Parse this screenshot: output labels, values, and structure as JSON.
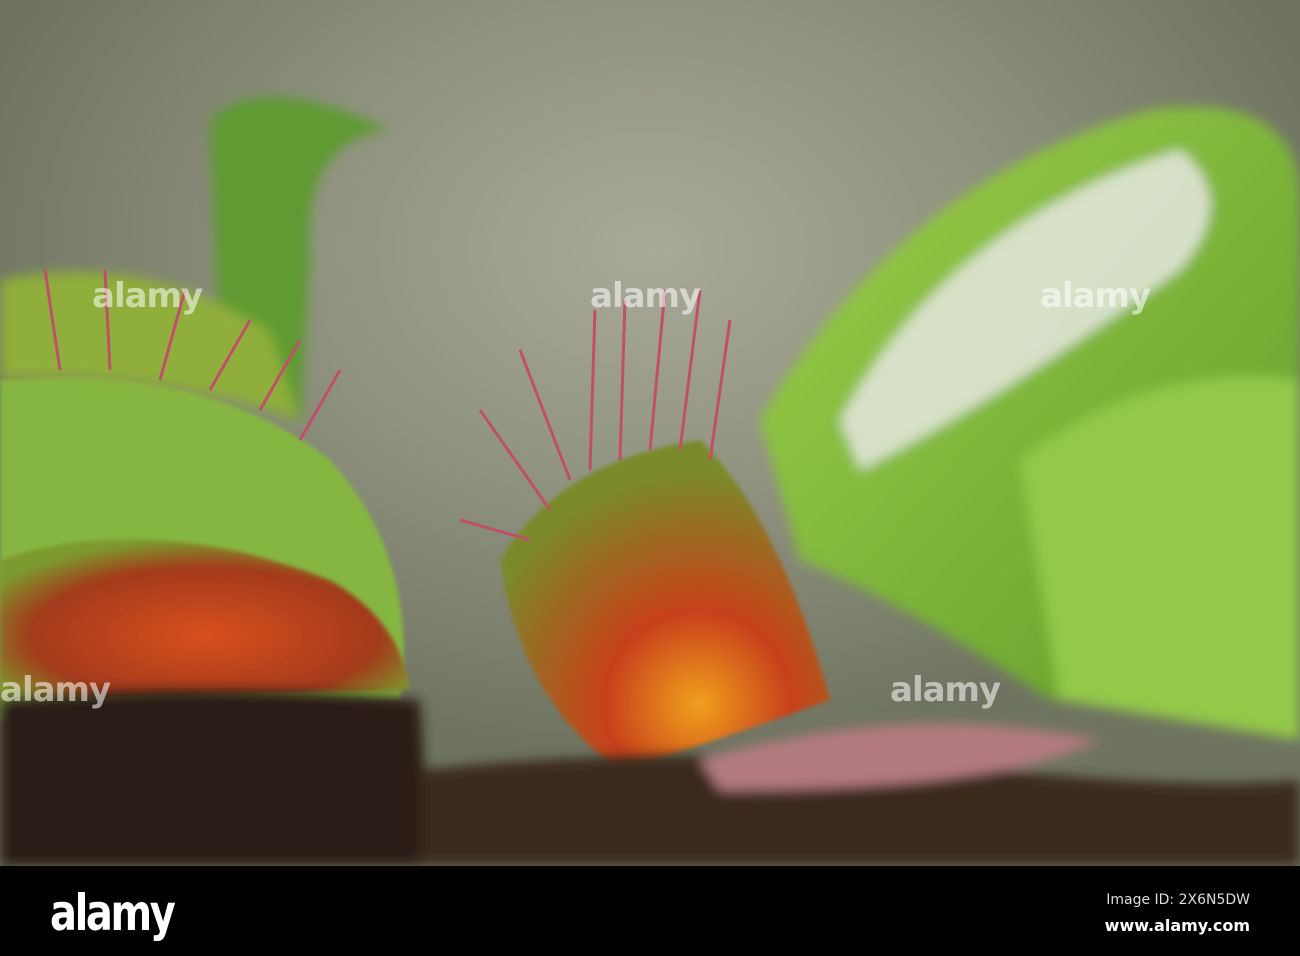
{
  "watermark": {
    "text": "alamy"
  },
  "footer": {
    "logo": "alamy",
    "image_id": "Image ID: 2X6N5DW",
    "url": "www.alamy.com"
  },
  "colors": {
    "background": "#8f927f",
    "trap_green": "#7fb83a",
    "trap_red": "#c24a1c",
    "soil": "#2a1c12"
  }
}
